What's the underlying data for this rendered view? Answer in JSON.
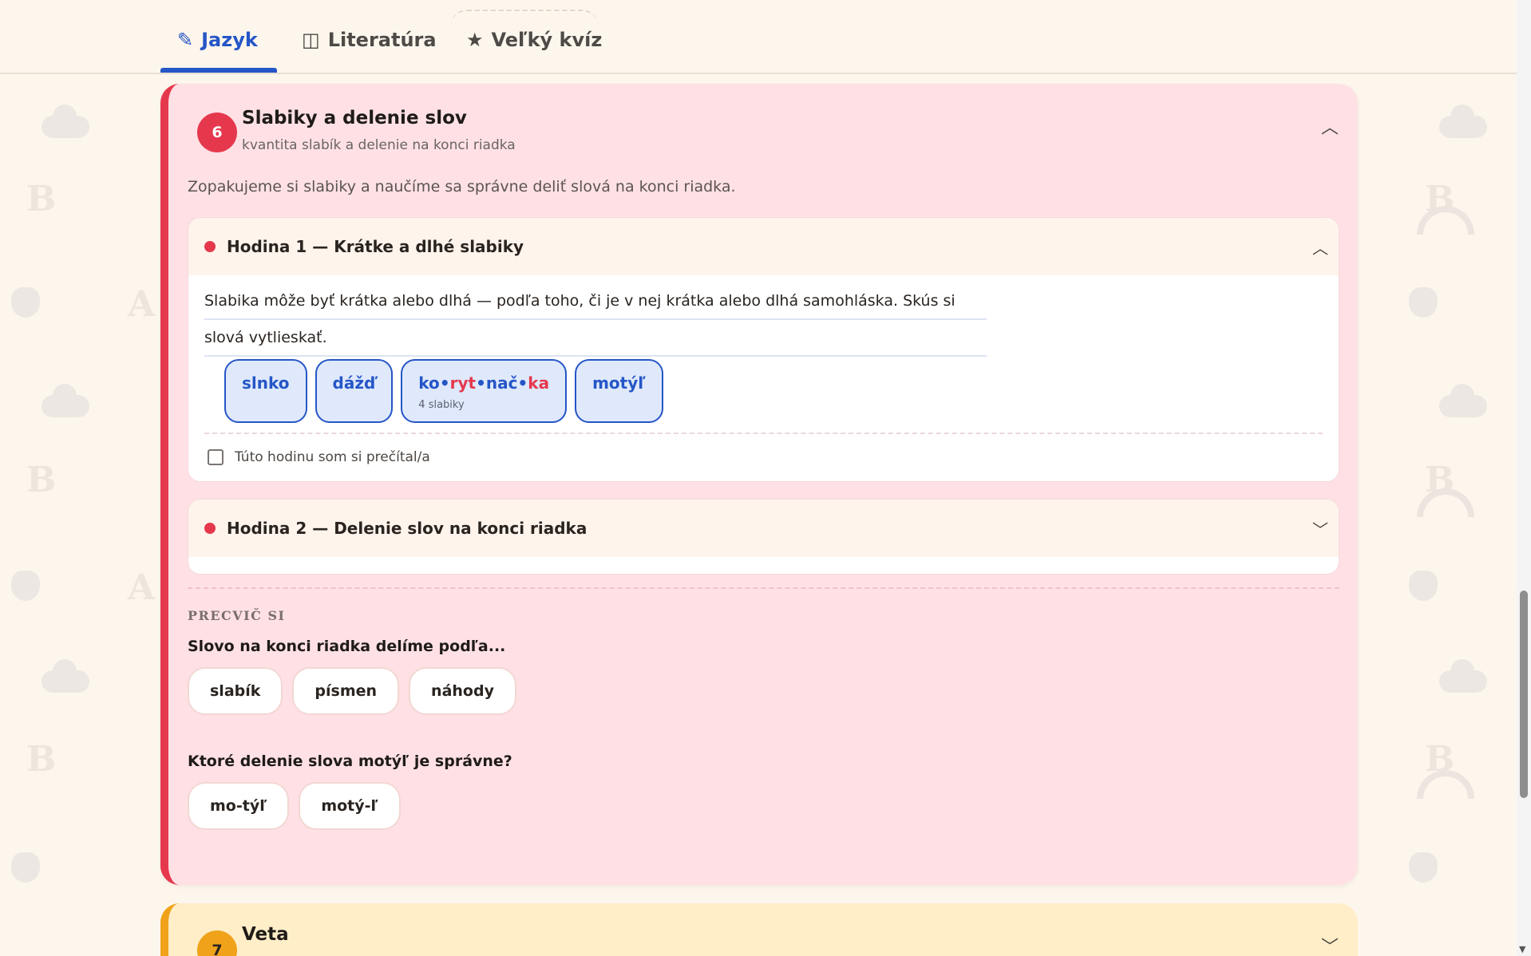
{
  "tabs": [
    {
      "label": "Jazyk",
      "icon": "pencil-icon",
      "active": true
    },
    {
      "label": "Literatúra",
      "icon": "book-icon",
      "active": false
    },
    {
      "label": "Veľký kvíz",
      "icon": "star-icon",
      "active": false
    }
  ],
  "lesson6": {
    "number": "6",
    "title": "Slabiky a delenie slov",
    "subtitle": "kvantita slabík a delenie na konci riadka",
    "description": "Zopakujeme si slabiky a naučíme sa správne deliť slová na konci riadka.",
    "hours": [
      {
        "title": "Hodina 1 — Krátke a dlhé slabiky",
        "expanded": true,
        "text_line1": "Slabika môže byť krátka alebo dlhá — podľa toho, či je v nej krátka alebo dlhá samohláska. Skús si",
        "text_line2": "slová vytlieskať.",
        "words": [
          {
            "label": "slnko"
          },
          {
            "label": "dážď"
          },
          {
            "syllables": [
              "ko",
              "ryt",
              "nač",
              "ka"
            ],
            "separator": "•",
            "note": "4 slabiky"
          },
          {
            "label": "motýľ"
          }
        ],
        "read_label": "Túto hodinu som si prečítal/a"
      },
      {
        "title": "Hodina 2 — Delenie slov na konci riadka",
        "expanded": false
      }
    ],
    "practice": {
      "label": "PRECVIČ SI",
      "questions": [
        {
          "text": "Slovo na konci riadka delíme podľa...",
          "options": [
            "slabík",
            "písmen",
            "náhody"
          ]
        },
        {
          "text": "Ktoré delenie slova motýľ je správne?",
          "options": [
            "mo-týľ",
            "motý-ľ"
          ]
        }
      ]
    }
  },
  "lesson7": {
    "number": "7",
    "title": "Veta"
  },
  "colors": {
    "accent_blue": "#2556c7",
    "lesson6_red": "#e5384d",
    "lesson6_bg": "#ffe1e5",
    "lesson7_orange": "#f0a21a",
    "page_bg": "#fdf6ec"
  }
}
